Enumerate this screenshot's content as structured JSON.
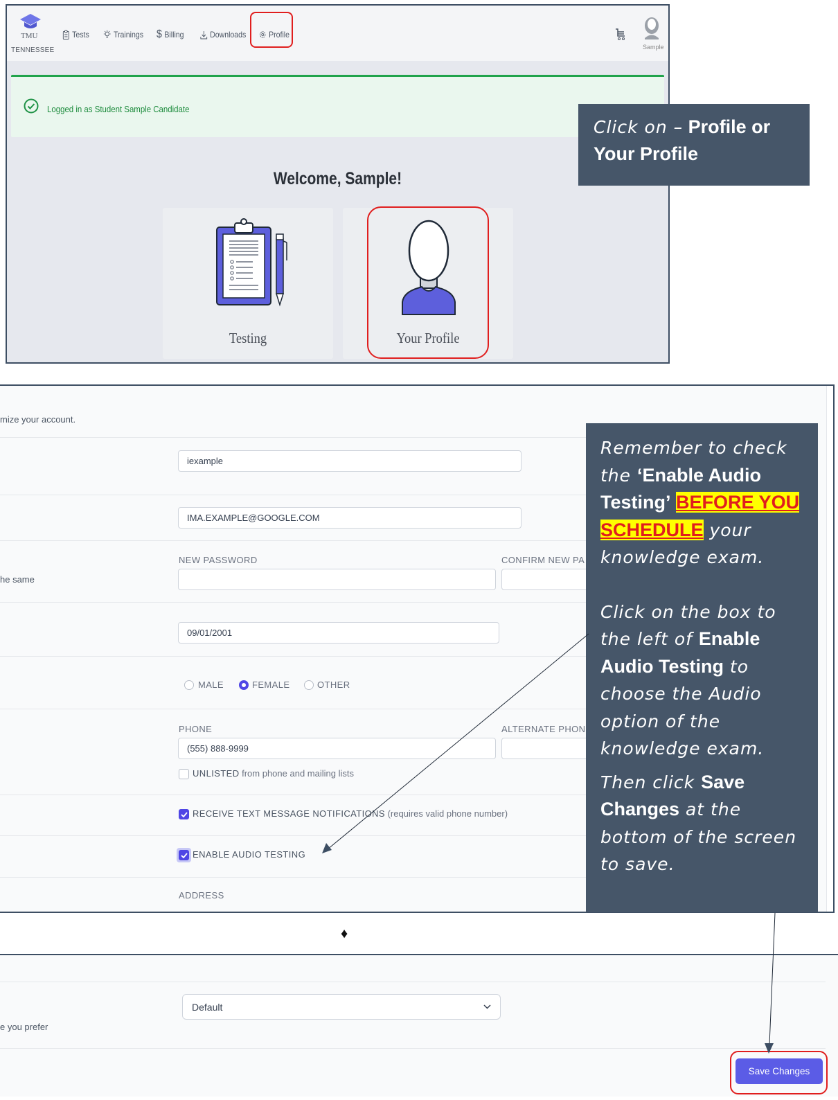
{
  "nav": {
    "logo_title": "TMU",
    "logo_subtitle": "TENNESSEE",
    "items": [
      {
        "label": "Tests",
        "icon": "clipboard-icon"
      },
      {
        "label": "Trainings",
        "icon": "lightbulb-icon"
      },
      {
        "label": "Billing",
        "icon": "dollar-icon"
      },
      {
        "label": "Downloads",
        "icon": "download-icon"
      },
      {
        "label": "Profile",
        "icon": "gear-icon"
      }
    ],
    "user_label": "Sample"
  },
  "alert": {
    "text": "Logged in as Student Sample Candidate"
  },
  "welcome": {
    "title": "Welcome, Sample!"
  },
  "cards": [
    {
      "label": "Testing",
      "icon": "clipboard-pencil-icon"
    },
    {
      "label": "Your Profile",
      "icon": "user-icon"
    }
  ],
  "callout1": {
    "prefix": "Click on –",
    "bold": " Profile or Your Profile"
  },
  "callout2": {
    "p1_a": "Remember to check the ",
    "p1_b": "‘Enable Audio Testing’",
    "p1_space": " ",
    "p1_highlight": "BEFORE YOU SCHEDULE",
    "p1_c": " your knowledge exam.",
    "p2_a": "Click on the box to the left of ",
    "p2_b": "Enable Audio Testing",
    "p2_c": " to choose the Audio option of the knowledge exam.",
    "p3_a": "Then click ",
    "p3_b": "Save Changes",
    "p3_c": " at the bottom of the screen to save."
  },
  "form": {
    "intro_fragment": "mize your account.",
    "username": "iexample",
    "email": "IMA.EXAMPLE@GOOGLE.COM",
    "password_fragment": "he same",
    "new_password_label": "NEW PASSWORD",
    "confirm_password_label": "CONFIRM NEW PA",
    "dob": "09/01/2001",
    "gender_options": [
      "MALE",
      "FEMALE",
      "OTHER"
    ],
    "gender_selected": "FEMALE",
    "phone_label": "PHONE",
    "alt_phone_label": "ALTERNATE PHON",
    "phone": "(555) 888-9999",
    "unlisted_label": "UNLISTED",
    "unlisted_rest": " from phone and mailing lists",
    "text_notif_label": "RECEIVE TEXT MESSAGE NOTIFICATIONS",
    "text_notif_rest": " (requires valid phone number)",
    "audio_label": "ENABLE AUDIO TESTING",
    "address_label": "ADDRESS"
  },
  "divider": "♦",
  "panel3": {
    "pref_fragment": "e you prefer",
    "select_value": "Default",
    "save_label": "Save Changes"
  },
  "colors": {
    "accent": "#4f46e5",
    "callout_bg": "#465669",
    "highlight_red": "#e01e1e",
    "success": "#21a34b"
  }
}
